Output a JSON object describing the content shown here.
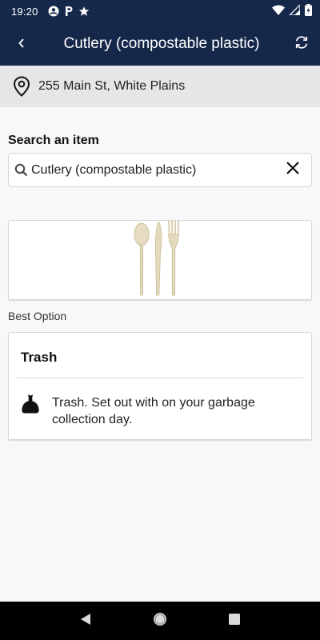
{
  "status_bar": {
    "time": "19:20",
    "icons": [
      "account-circle-icon",
      "parking-icon",
      "star-icon",
      "wifi-icon",
      "signal-icon",
      "battery-icon"
    ]
  },
  "app_bar": {
    "title": "Cutlery (compostable plastic)",
    "back_icon": "chevron-left-icon",
    "refresh_icon": "refresh-icon"
  },
  "location": {
    "address": "255 Main St, White Plains",
    "icon": "location-pin-icon"
  },
  "search": {
    "label": "Search an item",
    "value": "Cutlery (compostable plastic)",
    "icon": "search-icon",
    "clear_icon": "close-icon"
  },
  "item_image": {
    "icon": "cutlery-image"
  },
  "best_option": {
    "label": "Best Option",
    "title": "Trash",
    "icon": "garbage-bag-icon",
    "description": "Trash. Set out with on your garbage collection day."
  },
  "colors": {
    "header_bg": "#16284a",
    "location_bg": "#e6e6e6",
    "page_bg": "#f7f8f7"
  },
  "nav_bar": {
    "icons": [
      "back-triangle-icon",
      "home-circle-icon",
      "recents-square-icon"
    ]
  }
}
